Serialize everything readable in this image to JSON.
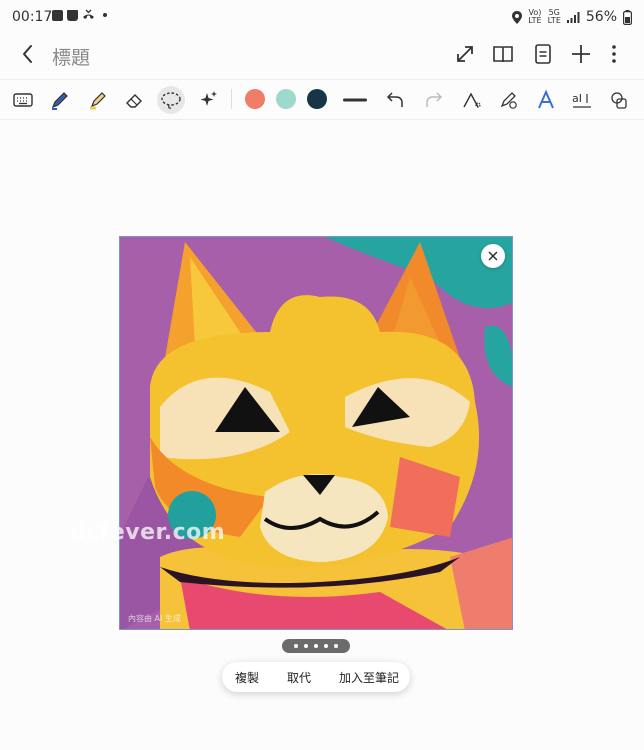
{
  "status_bar": {
    "time": "00:17",
    "network_label_top": "Vo)",
    "network_label_bottom": "LTE",
    "signal_label_top": "5G",
    "signal_label_bottom": "LTE",
    "battery": "56%",
    "icons": [
      "image-icon",
      "bag-icon",
      "missed-call-icon",
      "dot-icon",
      "location-icon",
      "signal-icon",
      "battery-icon"
    ]
  },
  "header": {
    "title": "標題",
    "icons": [
      "back-icon",
      "expand-icon",
      "book-icon",
      "note-icon",
      "add-icon",
      "more-icon"
    ]
  },
  "toolbar": {
    "tools": [
      "keyboard-icon",
      "pen-icon",
      "highlighter-icon",
      "eraser-icon",
      "lasso-icon",
      "sparkle-icon",
      "line-width-icon",
      "undo-icon",
      "redo-icon",
      "shape-icon",
      "pen-settings-icon",
      "text-style-icon",
      "text-convert-icon",
      "layers-icon"
    ],
    "colors": [
      "#f07d67",
      "#9ed9cd",
      "#183548"
    ]
  },
  "image": {
    "watermark": "dcfever.com",
    "ai_label": "內容由 AI 生成"
  },
  "context_menu": {
    "copy": "複製",
    "replace": "取代",
    "add_to_note": "加入至筆記"
  }
}
